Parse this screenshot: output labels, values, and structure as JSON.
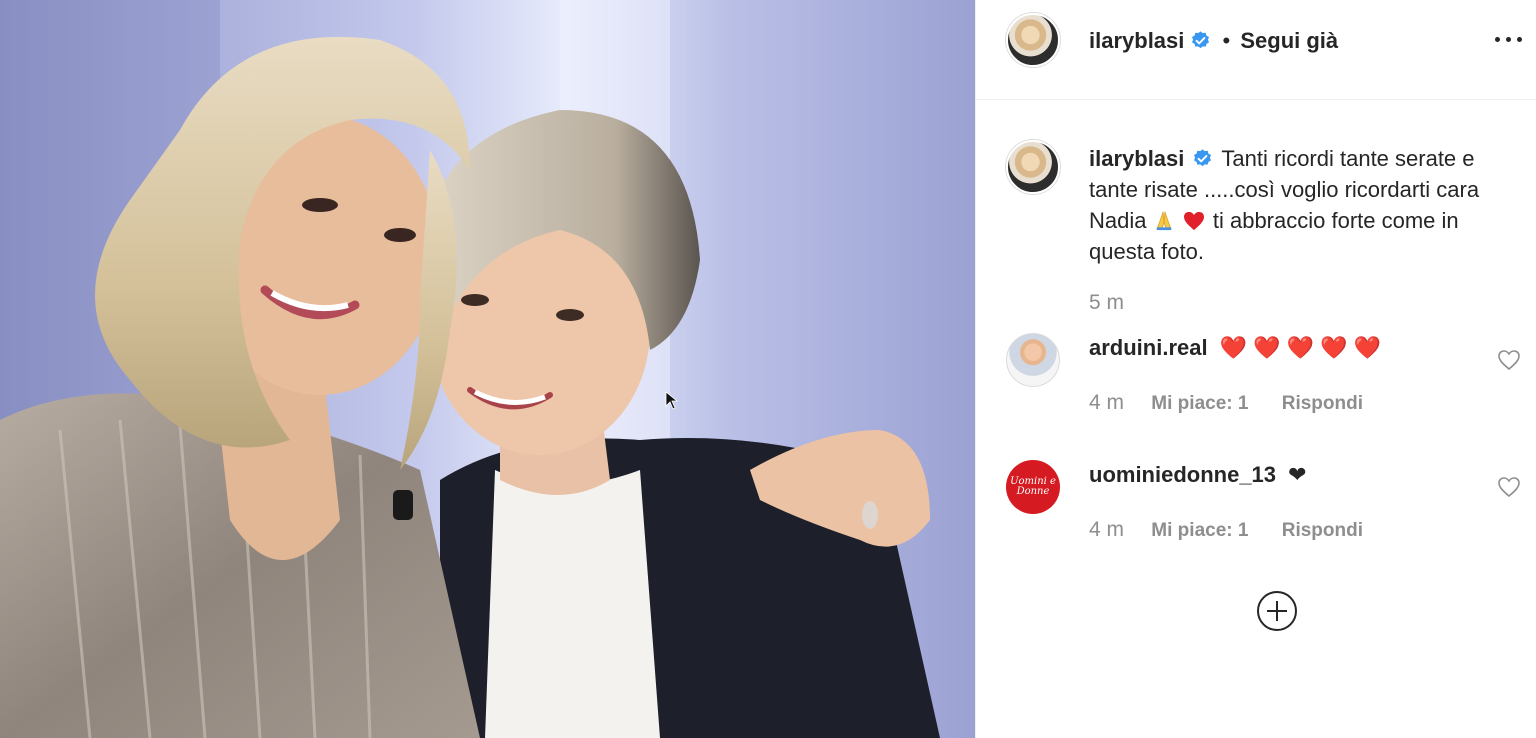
{
  "post": {
    "author": "ilaryblasi",
    "verified": true,
    "follow_separator": "•",
    "follow_status": "Segui già",
    "more_icon": "more-horizontal-icon"
  },
  "caption": {
    "author": "ilaryblasi",
    "part1": "Tanti ricordi tante serate e tante risate .....così voglio ricordarti cara Nadia",
    "emoji1": "pray-emoji",
    "emoji2": "red-heart-emoji",
    "part2": "ti abbraccio forte come in questa foto.",
    "time": "5 m"
  },
  "comments": [
    {
      "author": "arduini.real",
      "text": "❤️ ❤️ ❤️ ❤️ ❤️",
      "time": "4 m",
      "likes": "Mi piace: 1",
      "reply": "Rispondi"
    },
    {
      "author": "uominiedonne_13",
      "text": "❤",
      "time": "4 m",
      "likes": "Mi piace: 1",
      "reply": "Rispondi",
      "avatar_text": "Uomini e Donne"
    }
  ],
  "load_more_icon": "plus-circle-icon",
  "colors": {
    "verified_blue": "#3897f0",
    "heart_red": "#ed4956",
    "secondary_text": "#8e8e8e",
    "text": "#262626",
    "uomini_donne_red": "#d51b21"
  }
}
